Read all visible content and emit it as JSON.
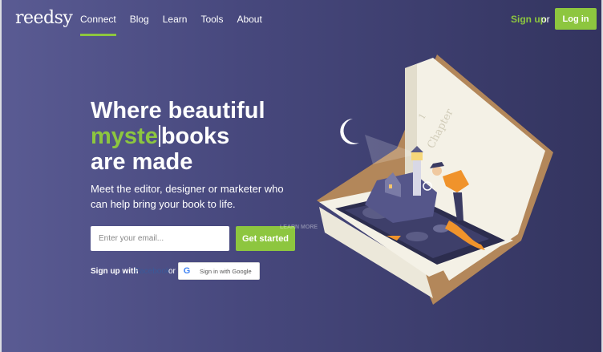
{
  "nav": {
    "logo": "reedsy",
    "links": [
      {
        "label": "Connect",
        "active": true
      },
      {
        "label": "Blog"
      },
      {
        "label": "Learn"
      },
      {
        "label": "Tools"
      },
      {
        "label": "About"
      }
    ],
    "signup_label": "Sign up",
    "or_label": "or",
    "login_label": "Log in"
  },
  "hero": {
    "headline_line1": "Where beautiful",
    "headline_typed": "myste",
    "headline_rest": "books",
    "headline_line3": "are made",
    "subtitle": "Meet the editor, designer or marketer who can help bring your book to life.",
    "email_placeholder": "Enter your email...",
    "cta_label": "Get started",
    "signup_with_label": "Sign up with",
    "facebook_label": "Facebook",
    "or_label": "or",
    "google_label": "Sign in with Google",
    "google_icon": "G"
  },
  "illustration": {
    "book_text": "Chapter",
    "chapter_number": "1",
    "watermark": "LEARN MORE"
  },
  "colors": {
    "accent": "#8dc63f",
    "facebook": "#3b5998",
    "background_start": "#5a5b93",
    "background_end": "#33345f"
  }
}
